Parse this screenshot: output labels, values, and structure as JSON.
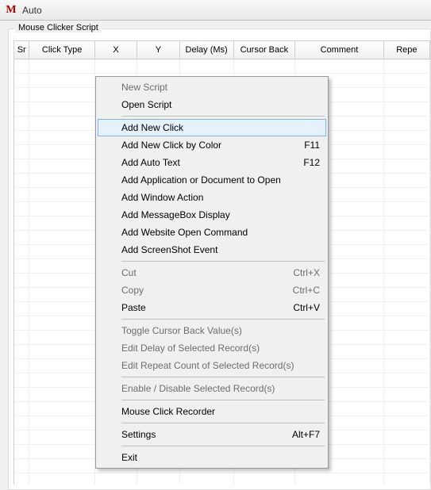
{
  "window": {
    "icon_text": "M",
    "title": "Auto"
  },
  "groupbox": {
    "title": "Mouse Clicker Script"
  },
  "table": {
    "columns": [
      "Sr",
      "Click Type",
      "X",
      "Y",
      "Delay (Ms)",
      "Cursor Back",
      "Comment",
      "Repe"
    ]
  },
  "context_menu": {
    "groups": [
      [
        {
          "label": "New Script",
          "shortcut": "",
          "enabled": false,
          "highlighted": false
        },
        {
          "label": "Open Script",
          "shortcut": "",
          "enabled": true,
          "highlighted": false
        }
      ],
      [
        {
          "label": "Add New Click",
          "shortcut": "",
          "enabled": true,
          "highlighted": true
        },
        {
          "label": "Add New Click by Color",
          "shortcut": "F11",
          "enabled": true,
          "highlighted": false
        },
        {
          "label": "Add Auto Text",
          "shortcut": "F12",
          "enabled": true,
          "highlighted": false
        },
        {
          "label": "Add Application or Document to Open",
          "shortcut": "",
          "enabled": true,
          "highlighted": false
        },
        {
          "label": "Add Window Action",
          "shortcut": "",
          "enabled": true,
          "highlighted": false
        },
        {
          "label": "Add MessageBox Display",
          "shortcut": "",
          "enabled": true,
          "highlighted": false
        },
        {
          "label": "Add Website Open Command",
          "shortcut": "",
          "enabled": true,
          "highlighted": false
        },
        {
          "label": "Add ScreenShot Event",
          "shortcut": "",
          "enabled": true,
          "highlighted": false
        }
      ],
      [
        {
          "label": "Cut",
          "shortcut": "Ctrl+X",
          "enabled": false,
          "highlighted": false
        },
        {
          "label": "Copy",
          "shortcut": "Ctrl+C",
          "enabled": false,
          "highlighted": false
        },
        {
          "label": "Paste",
          "shortcut": "Ctrl+V",
          "enabled": true,
          "highlighted": false
        }
      ],
      [
        {
          "label": "Toggle Cursor Back Value(s)",
          "shortcut": "",
          "enabled": false,
          "highlighted": false
        },
        {
          "label": "Edit Delay of Selected Record(s)",
          "shortcut": "",
          "enabled": false,
          "highlighted": false
        },
        {
          "label": "Edit Repeat Count of Selected Record(s)",
          "shortcut": "",
          "enabled": false,
          "highlighted": false
        }
      ],
      [
        {
          "label": "Enable / Disable Selected Record(s)",
          "shortcut": "",
          "enabled": false,
          "highlighted": false
        }
      ],
      [
        {
          "label": "Mouse Click Recorder",
          "shortcut": "",
          "enabled": true,
          "highlighted": false
        }
      ],
      [
        {
          "label": "Settings",
          "shortcut": "Alt+F7",
          "enabled": true,
          "highlighted": false
        }
      ],
      [
        {
          "label": "Exit",
          "shortcut": "",
          "enabled": true,
          "highlighted": false
        }
      ]
    ]
  }
}
